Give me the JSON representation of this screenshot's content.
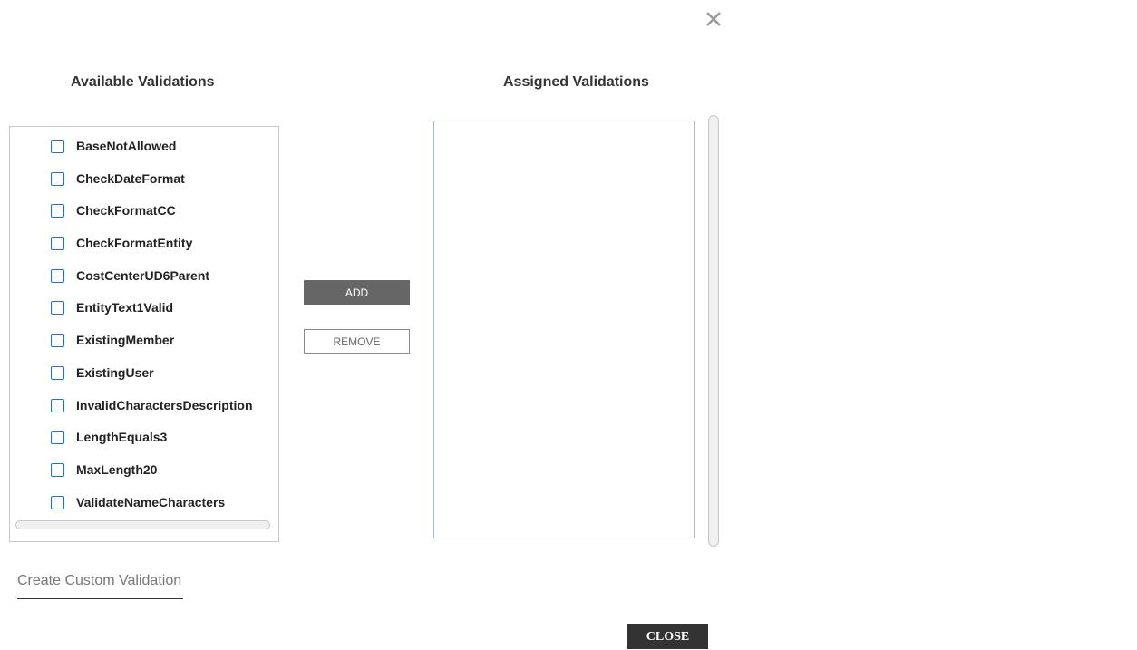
{
  "dialog": {
    "close_icon": "close-x-icon",
    "available_title": "Available Validations",
    "assigned_title": "Assigned Validations",
    "available_items": [
      {
        "label": "BaseNotAllowed",
        "checked": false
      },
      {
        "label": "CheckDateFormat",
        "checked": false
      },
      {
        "label": "CheckFormatCC",
        "checked": false
      },
      {
        "label": "CheckFormatEntity",
        "checked": false
      },
      {
        "label": "CostCenterUD6Parent",
        "checked": false
      },
      {
        "label": "EntityText1Valid",
        "checked": false
      },
      {
        "label": "ExistingMember",
        "checked": false
      },
      {
        "label": "ExistingUser",
        "checked": false
      },
      {
        "label": "InvalidCharactersDescription",
        "checked": false
      },
      {
        "label": "LengthEquals3",
        "checked": false
      },
      {
        "label": "MaxLength20",
        "checked": false
      },
      {
        "label": "ValidateNameCharacters",
        "checked": false
      }
    ],
    "assigned_items": [],
    "add_label": "ADD",
    "remove_label": "REMOVE",
    "custom_link": "Create Custom Validation",
    "close_label": "CLOSE",
    "colors": {
      "checkbox_border": "#2d6db5",
      "add_bg": "#666666",
      "close_bg": "#333333"
    }
  }
}
